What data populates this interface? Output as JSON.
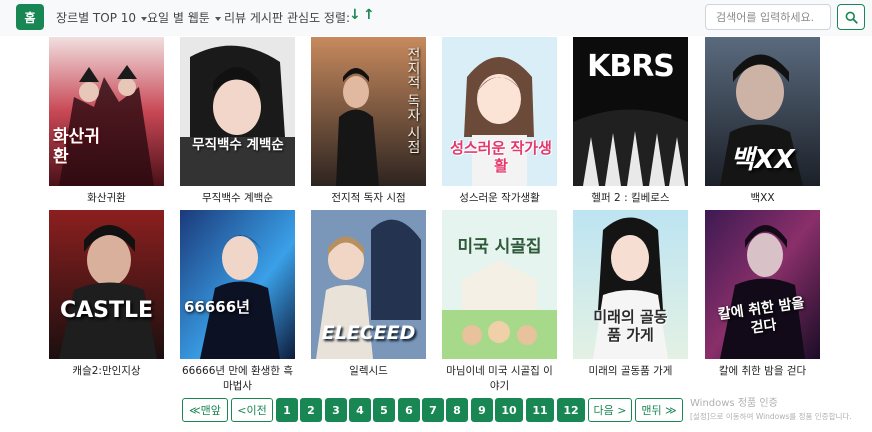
{
  "navbar": {
    "home_label": "홈",
    "genre_top_label": "장르별 TOP 10",
    "weekday_label": "요일 별 웹툰",
    "review_label": "리뷰 게시판",
    "sort_label": "관심도 정렬:",
    "sort_down": "↓",
    "sort_up": "↑",
    "search_placeholder": "검색어를 입력하세요."
  },
  "webtoons": [
    {
      "title": "화산귀환",
      "cover_text": "화산귀환"
    },
    {
      "title": "무직백수 계백순",
      "cover_text": "무직백수 계백순"
    },
    {
      "title": "전지적 독자 시점",
      "cover_text": "전지적 독자 시점"
    },
    {
      "title": "성스러운 작가생활",
      "cover_text": "성스러운 작가생활"
    },
    {
      "title": "헬퍼 2 : 킬베로스",
      "cover_text": "KBRS"
    },
    {
      "title": "백XX",
      "cover_text": "백XX"
    },
    {
      "title": "캐슬2:만인지상",
      "cover_text": "CASTLE"
    },
    {
      "title": "66666년 만에 환생한 흑마법사",
      "cover_text": "66666년"
    },
    {
      "title": "일렉시드",
      "cover_text": "ELECEED"
    },
    {
      "title": "마님이네 미국 시골집 이야기",
      "cover_text": "미국 시골집"
    },
    {
      "title": "미래의 골동품 가게",
      "cover_text": "미래의 골동품 가게"
    },
    {
      "title": "칼에 취한 밤을 걷다",
      "cover_text": "칼에 취한 밤을 걷다"
    }
  ],
  "pagination": {
    "first_label": "≪맨앞",
    "prev_label": "<이전",
    "pages": [
      "1",
      "2",
      "3",
      "4",
      "5",
      "6",
      "7",
      "8",
      "9",
      "10",
      "11",
      "12"
    ],
    "next_label": "다음 >",
    "last_label": "맨뒤 ≫"
  },
  "watermark": {
    "line1": "Windows 정품 인증",
    "line2": "[설정]으로 이동하여 Windows를 정품 인증합니다."
  },
  "colors": {
    "accent": "#198754",
    "navbar_bg": "#f8f9fa"
  }
}
